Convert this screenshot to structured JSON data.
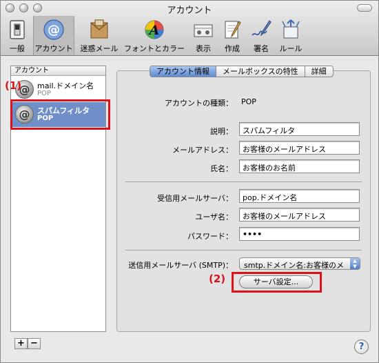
{
  "window": {
    "title": "アカウント"
  },
  "toolbar": {
    "items": [
      {
        "label": "一般",
        "icon": "switch-icon"
      },
      {
        "label": "アカウント",
        "icon": "at-sign-icon"
      },
      {
        "label": "迷惑メール",
        "icon": "junk-mail-icon"
      },
      {
        "label": "フォントとカラー",
        "icon": "font-color-icon"
      },
      {
        "label": "表示",
        "icon": "view-icon"
      },
      {
        "label": "作成",
        "icon": "compose-icon"
      },
      {
        "label": "署名",
        "icon": "signature-icon"
      },
      {
        "label": "ルール",
        "icon": "rules-icon"
      }
    ]
  },
  "sidebar": {
    "header": "アカウント",
    "accounts": [
      {
        "name": "mail.ドメイン名",
        "type": "POP",
        "selected": false
      },
      {
        "name": "スパムフィルタ",
        "type": "POP",
        "selected": true
      }
    ],
    "add_label": "+",
    "remove_label": "−"
  },
  "annotations": {
    "label1": "(1)",
    "label2": "(2)",
    "color": "#e0101b"
  },
  "tabs": [
    {
      "label": "アカウント情報",
      "active": true
    },
    {
      "label": "メールボックスの特性",
      "active": false
    },
    {
      "label": "詳細",
      "active": false
    }
  ],
  "form": {
    "account_type_label": "アカウントの種類：",
    "account_type_value": "POP",
    "description_label": "説明：",
    "description_value": "スパムフィルタ",
    "email_label": "メールアドレス：",
    "email_value": "お客様のメールアドレス",
    "fullname_label": "氏名：",
    "fullname_value": "お客様のお名前",
    "incoming_label": "受信用メールサーバ：",
    "incoming_value": "pop.ドメイン名",
    "username_label": "ユーザ名：",
    "username_value": "お客様のメールアドレス",
    "password_label": "パスワード：",
    "password_value": "••••",
    "outgoing_label": "送信用メールサーバ (SMTP)：",
    "outgoing_value": "smtp.ドメイン名:お客様のメ",
    "server_settings_button": "サーバ設定..."
  },
  "help": {
    "label": "?"
  }
}
